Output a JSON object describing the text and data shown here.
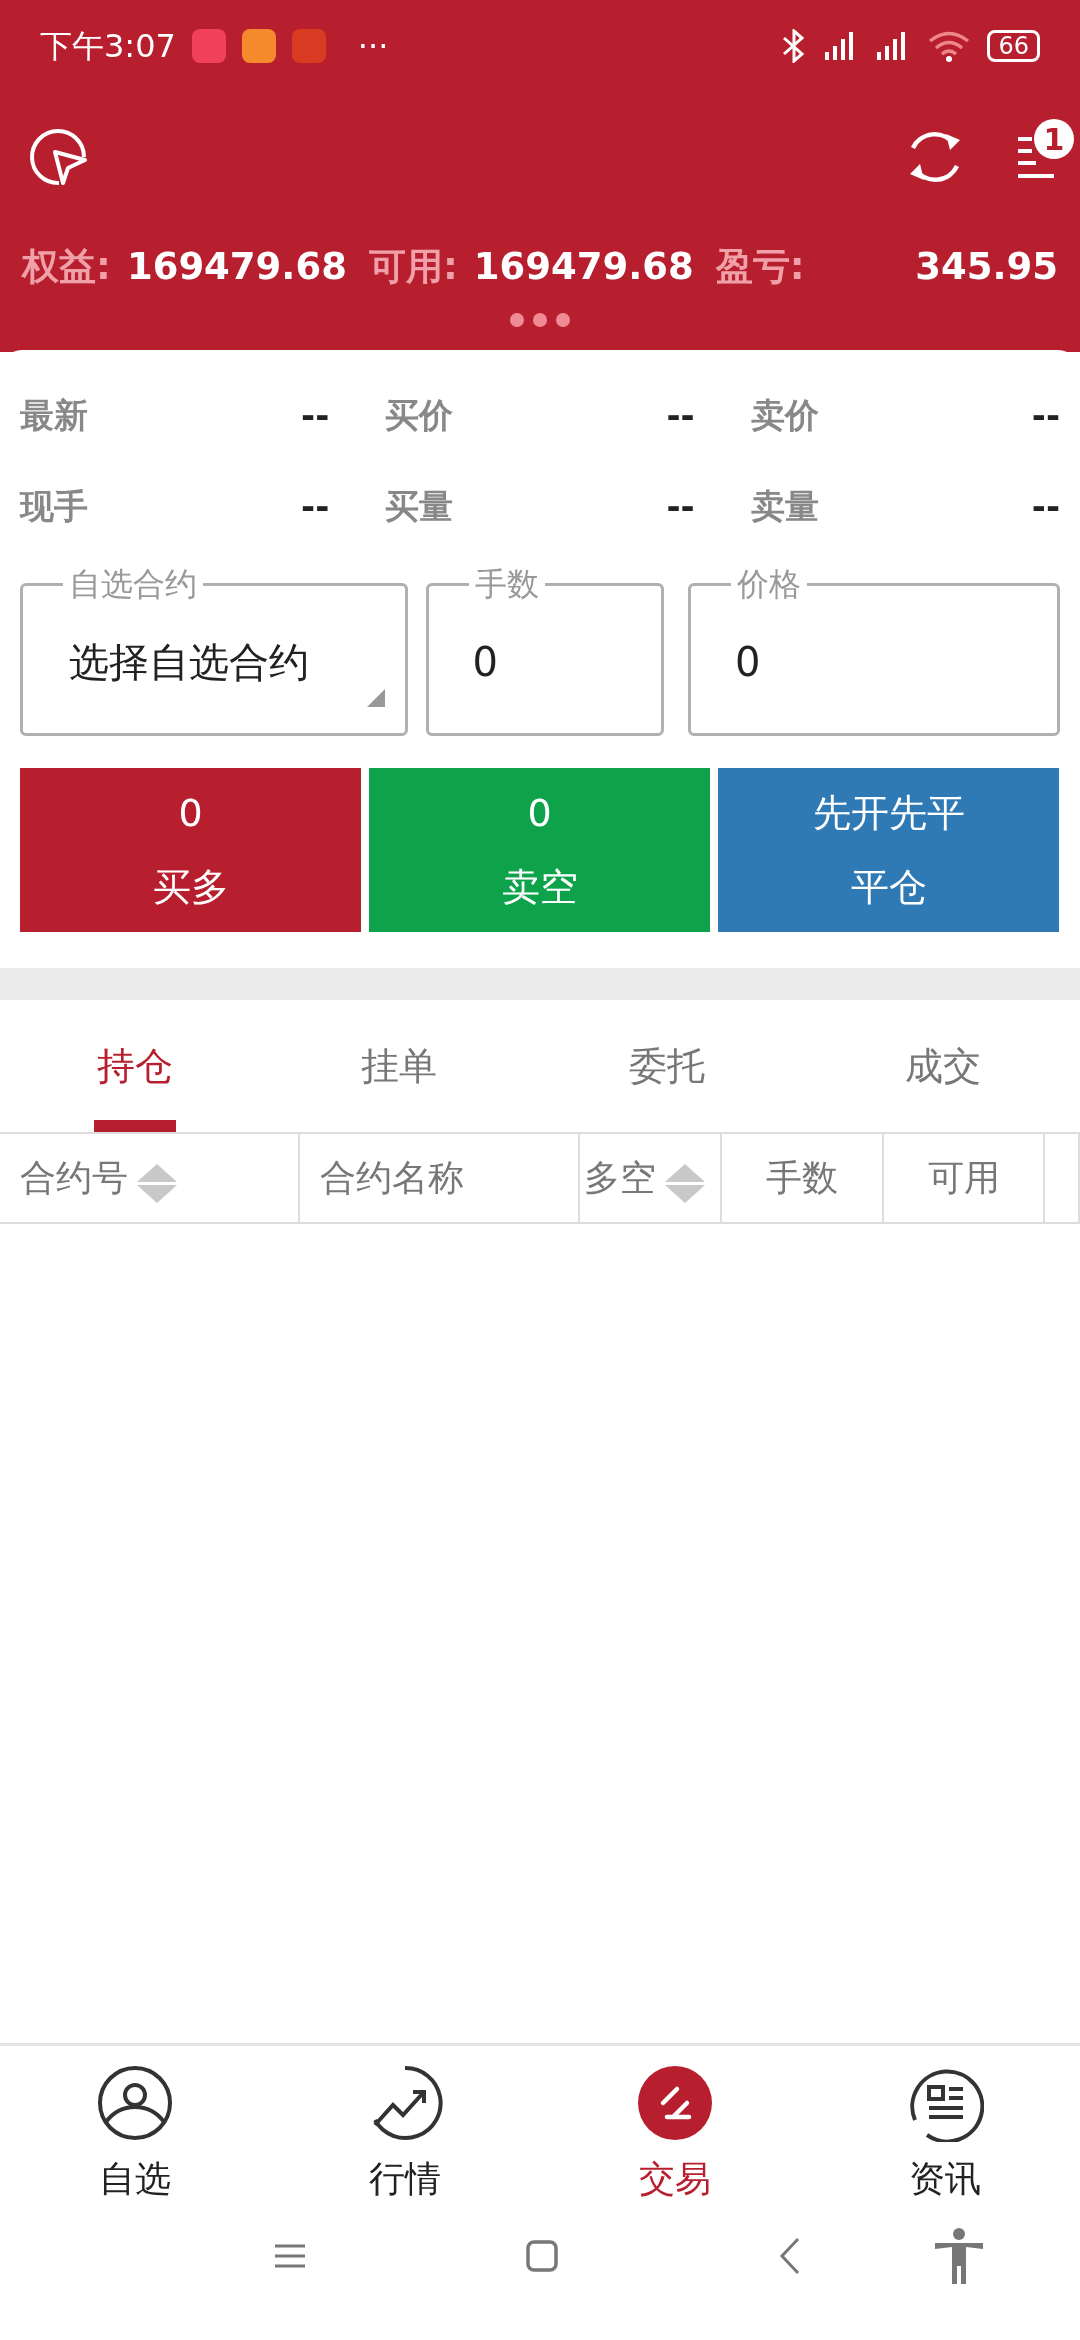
{
  "status_bar": {
    "time": "下午3:07",
    "more": "···",
    "battery": "66"
  },
  "header": {
    "notification_count": "1"
  },
  "account": [
    {
      "label": "权益:",
      "value": "169479.68"
    },
    {
      "label": "可用:",
      "value": "169479.68"
    },
    {
      "label": "盈亏:",
      "value": "345.95"
    }
  ],
  "quotes": [
    {
      "label": "最新",
      "value": "--"
    },
    {
      "label": "买价",
      "value": "--"
    },
    {
      "label": "卖价",
      "value": "--"
    },
    {
      "label": "现手",
      "value": "--"
    },
    {
      "label": "买量",
      "value": "--"
    },
    {
      "label": "卖量",
      "value": "--"
    }
  ],
  "order_form": {
    "contract": {
      "label": "自选合约",
      "value": "选择自选合约"
    },
    "lots": {
      "label": "手数",
      "value": "0"
    },
    "price": {
      "label": "价格",
      "value": "0"
    }
  },
  "actions": [
    {
      "kind": "buy",
      "count": "0",
      "label": "买多"
    },
    {
      "kind": "sell",
      "count": "0",
      "label": "卖空"
    },
    {
      "kind": "close",
      "count": "先开先平",
      "label": "平仓"
    }
  ],
  "tabs": [
    {
      "label": "持仓",
      "selected": true
    },
    {
      "label": "挂单",
      "selected": false
    },
    {
      "label": "委托",
      "selected": false
    },
    {
      "label": "成交",
      "selected": false
    }
  ],
  "table": {
    "columns": [
      {
        "label": "合约号",
        "sortable": true
      },
      {
        "label": "合约名称",
        "sortable": false
      },
      {
        "label": "多空",
        "sortable": true
      },
      {
        "label": "手数",
        "sortable": false
      },
      {
        "label": "可用",
        "sortable": false
      }
    ]
  },
  "bottom_nav": [
    {
      "kind": "person",
      "label": "自选",
      "selected": false
    },
    {
      "kind": "trend",
      "label": "行情",
      "selected": false
    },
    {
      "kind": "trade",
      "label": "交易",
      "selected": true
    },
    {
      "kind": "news",
      "label": "资讯",
      "selected": false
    }
  ]
}
